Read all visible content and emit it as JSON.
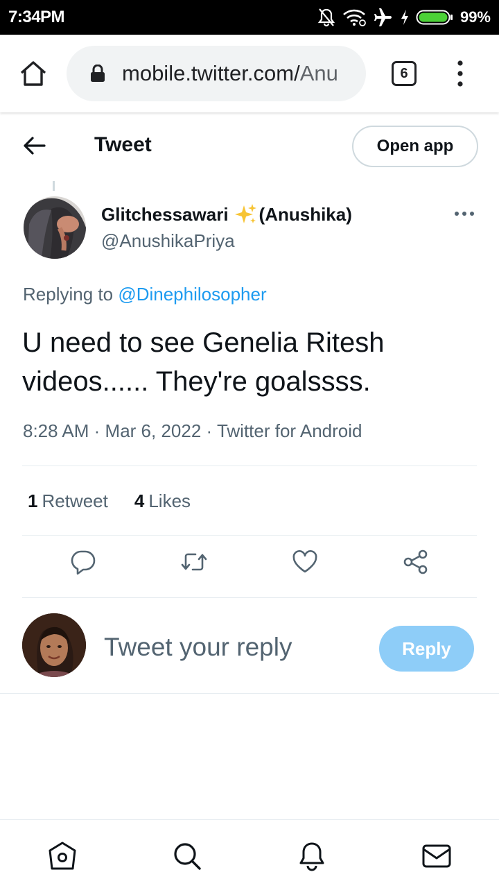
{
  "status_bar": {
    "time": "7:34PM",
    "battery_percent": "99%",
    "icons": [
      "notifications-off-icon",
      "wifi-icon",
      "airplane-mode-icon",
      "charging-icon",
      "battery-icon"
    ]
  },
  "browser": {
    "url_host": "mobile.twitter.com/",
    "url_path": "Anu",
    "tab_count": "6"
  },
  "header": {
    "title": "Tweet",
    "open_app_label": "Open app"
  },
  "tweet": {
    "author_name": "Glitchessawari",
    "author_name_suffix": "(Anushika)",
    "handle": "@AnushikaPriya",
    "replying_prefix": "Replying to",
    "replying_to": "@Dinephilosopher",
    "text": "U need to see Genelia Ritesh videos...... They're goalssss.",
    "time": "8:28 AM",
    "date": "Mar 6, 2022",
    "source": "Twitter for Android",
    "retweet_count": "1",
    "retweet_label": "Retweet",
    "like_count": "4",
    "like_label": "Likes"
  },
  "composer": {
    "placeholder": "Tweet your reply",
    "reply_label": "Reply"
  },
  "colors": {
    "accent": "#1d9bf0",
    "reply_button_disabled": "#8ecdf8",
    "secondary_text": "#536471",
    "battery_green": "#4cd137"
  }
}
